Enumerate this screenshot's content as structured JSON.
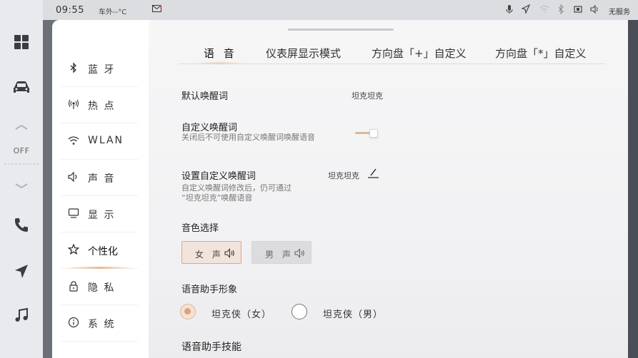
{
  "status_bar": {
    "time": "09:55",
    "outside_temp": "车外--°C",
    "service_status": "无服务",
    "icons": [
      "mail-icon",
      "microphone-icon",
      "navigation-icon",
      "wifi-icon",
      "bluetooth-icon",
      "dashcam-icon",
      "speaker-icon"
    ]
  },
  "dock": {
    "climate_label": "OFF",
    "icons": [
      "apps-grid-icon",
      "car-icon",
      "chevron-up-icon",
      "chevron-down-icon",
      "phone-icon",
      "navigation-icon",
      "music-icon"
    ]
  },
  "menu": {
    "items": [
      {
        "label": "蓝 牙",
        "icon": "bluetooth-icon"
      },
      {
        "label": "热 点",
        "icon": "hotspot-icon"
      },
      {
        "label": "WLAN",
        "icon": "wifi-icon"
      },
      {
        "label": "声 音",
        "icon": "speaker-icon"
      },
      {
        "label": "显 示",
        "icon": "display-icon"
      },
      {
        "label": "个性化",
        "icon": "personalize-icon",
        "active": true
      },
      {
        "label": "隐 私",
        "icon": "lock-icon"
      },
      {
        "label": "系 统",
        "icon": "info-icon"
      }
    ]
  },
  "tabs": [
    {
      "label": "语 音",
      "active": true
    },
    {
      "label": "仪表屏显示模式"
    },
    {
      "label": "方向盘「+」自定义"
    },
    {
      "label": "方向盘「*」自定义"
    }
  ],
  "voice": {
    "default_wake_label": "默认唤醒词",
    "default_wake_value": "坦克坦克",
    "custom_wake_label": "自定义唤醒词",
    "custom_wake_desc": "关闭后不可使用自定义唤醒词唤醒语音",
    "custom_wake_enabled": true,
    "set_custom_label": "设置自定义唤醒词",
    "set_custom_value": "坦克坦克",
    "set_custom_desc_1": "自定义唤醒词修改后，仍可通过",
    "set_custom_desc_2": "“坦克坦克”唤醒语音",
    "timbre_label": "音色选择",
    "timbre_female": "女 声",
    "timbre_male": "男 声",
    "timbre_selected": "female",
    "avatar_label": "语音助手形象",
    "avatar_options": [
      "坦克侠（女）",
      "坦克侠（男）"
    ],
    "avatar_selected": 0,
    "skills_label": "语音助手技能"
  },
  "colors": {
    "accent": "#d9a27e",
    "toggle_track": "#d8b99a",
    "selected_button_bg": "#f1e4db",
    "selected_button_border": "#e4a487"
  }
}
